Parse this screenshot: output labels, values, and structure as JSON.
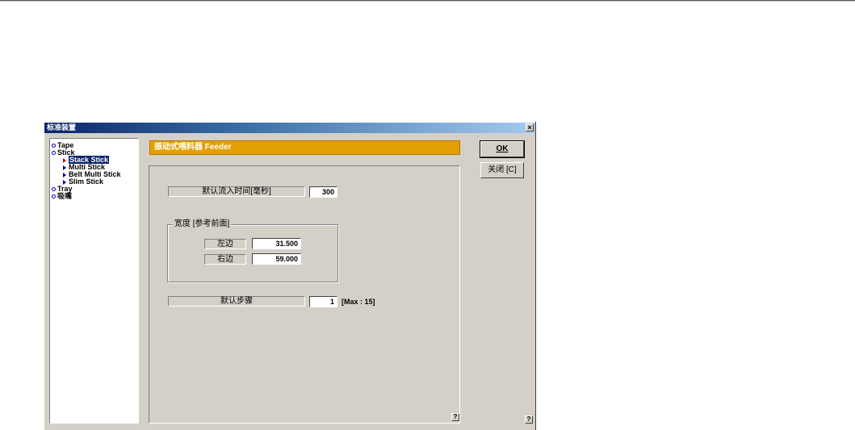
{
  "window": {
    "title": "标准装置",
    "close_label": "×"
  },
  "tree": {
    "items": [
      {
        "label": "Tape",
        "level": 0,
        "selected": false
      },
      {
        "label": "Stick",
        "level": 0,
        "selected": false
      },
      {
        "label": "Stack Stick",
        "level": 1,
        "selected": true
      },
      {
        "label": "Multi Stick",
        "level": 1,
        "selected": false
      },
      {
        "label": "Belt Multi Stick",
        "level": 1,
        "selected": false
      },
      {
        "label": "Slim Stick",
        "level": 1,
        "selected": false
      },
      {
        "label": "Tray",
        "level": 0,
        "selected": false
      },
      {
        "label": "吸嘴",
        "level": 0,
        "selected": false
      }
    ]
  },
  "header": {
    "title": "振动式喂料器 Feeder",
    "color": "#e2a004"
  },
  "form": {
    "inflow_time_label": "默认流入时间[毫秒]",
    "inflow_time_value": "300",
    "width_group_title": "宽度 [参考前面]",
    "left_label": "左边",
    "left_value": "31.500",
    "right_label": "右边",
    "right_value": "59.000",
    "step_label": "默认步骤",
    "step_value": "1",
    "step_hint": "[Max : 15]"
  },
  "buttons": {
    "ok_label": "OK",
    "close_label": "关闭 [C]",
    "help_label": "?"
  }
}
